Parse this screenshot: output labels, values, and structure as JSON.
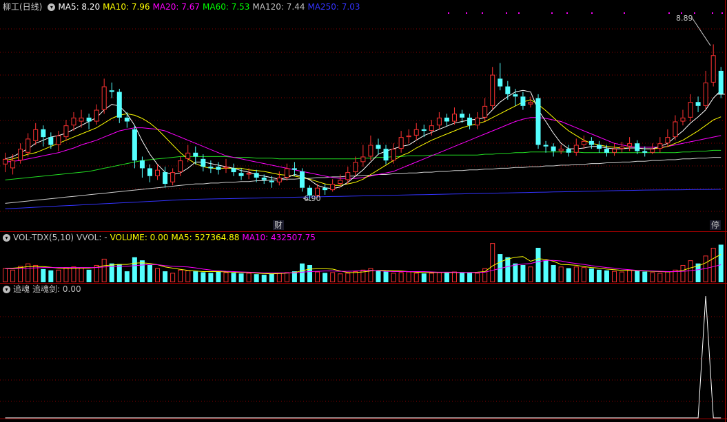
{
  "panel1": {
    "title": "柳工(日线)",
    "indicators": [
      {
        "label": "MA5: 8.20",
        "color": "#ffffff"
      },
      {
        "label": "MA10: 7.96",
        "color": "#ffff00"
      },
      {
        "label": "MA20: 7.67",
        "color": "#ff00ff"
      },
      {
        "label": "MA60: 7.53",
        "color": "#00ff00"
      },
      {
        "label": "MA120: 7.44",
        "color": "#c0c0c0"
      },
      {
        "label": "MA250: 7.03",
        "color": "#3333ff"
      }
    ],
    "high_label": "8.89",
    "low_label": "6.90",
    "marker_cai": "财",
    "marker_ting": "停"
  },
  "panel2": {
    "title": "VOL-TDX(5,10)",
    "indicators": [
      {
        "label": "VVOL: -",
        "color": "#c0c0c0"
      },
      {
        "label": "VOLUME: 0.00",
        "color": "#ffff00"
      },
      {
        "label": "MA5: 527364.88",
        "color": "#ffff00"
      },
      {
        "label": "MA10: 432507.75",
        "color": "#ff00ff"
      }
    ]
  },
  "panel3": {
    "title": "追魂",
    "indicators": [
      {
        "label": "追魂剑: 0.00",
        "color": "#c0c0c0"
      }
    ]
  },
  "colors": {
    "up": "#ff3232",
    "down": "#54ffff",
    "grid": "#8b0000",
    "border": "#b00000"
  },
  "chart_data": {
    "type": "candlestick",
    "title": "柳工(日线)",
    "ylim": [
      6.5,
      9.3
    ],
    "candles": [
      [
        7.35,
        7.42,
        7.5,
        7.25
      ],
      [
        7.3,
        7.4,
        7.48,
        7.22
      ],
      [
        7.4,
        7.55,
        7.62,
        7.36
      ],
      [
        7.5,
        7.68,
        7.75,
        7.45
      ],
      [
        7.65,
        7.8,
        7.88,
        7.6
      ],
      [
        7.8,
        7.7,
        7.85,
        7.58
      ],
      [
        7.7,
        7.6,
        7.76,
        7.55
      ],
      [
        7.6,
        7.72,
        7.78,
        7.52
      ],
      [
        7.7,
        7.85,
        7.92,
        7.65
      ],
      [
        7.85,
        7.95,
        8.02,
        7.78
      ],
      [
        7.9,
        7.95,
        8.05,
        7.82
      ],
      [
        7.95,
        7.9,
        8.0,
        7.8
      ],
      [
        7.9,
        8.05,
        8.12,
        7.86
      ],
      [
        8.05,
        8.35,
        8.45,
        8.0
      ],
      [
        8.3,
        8.28,
        8.4,
        8.2
      ],
      [
        8.28,
        7.95,
        8.32,
        7.88
      ],
      [
        7.95,
        7.9,
        8.02,
        7.82
      ],
      [
        7.8,
        7.4,
        7.85,
        7.3
      ],
      [
        7.4,
        7.3,
        7.45,
        7.18
      ],
      [
        7.3,
        7.2,
        7.35,
        7.12
      ],
      [
        7.2,
        7.28,
        7.35,
        7.15
      ],
      [
        7.25,
        7.1,
        7.32,
        7.05
      ],
      [
        7.12,
        7.25,
        7.3,
        7.08
      ],
      [
        7.25,
        7.4,
        7.45,
        7.2
      ],
      [
        7.42,
        7.5,
        7.6,
        7.38
      ],
      [
        7.5,
        7.45,
        7.58,
        7.35
      ],
      [
        7.42,
        7.32,
        7.48,
        7.26
      ],
      [
        7.32,
        7.3,
        7.4,
        7.24
      ],
      [
        7.32,
        7.28,
        7.38,
        7.22
      ],
      [
        7.3,
        7.32,
        7.42,
        7.24
      ],
      [
        7.3,
        7.25,
        7.36,
        7.2
      ],
      [
        7.24,
        7.2,
        7.3,
        7.15
      ],
      [
        7.22,
        7.24,
        7.3,
        7.16
      ],
      [
        7.24,
        7.18,
        7.28,
        7.12
      ],
      [
        7.18,
        7.15,
        7.22,
        7.1
      ],
      [
        7.14,
        7.12,
        7.2,
        7.05
      ],
      [
        7.12,
        7.18,
        7.26,
        7.08
      ],
      [
        7.18,
        7.3,
        7.36,
        7.14
      ],
      [
        7.3,
        7.28,
        7.38,
        7.2
      ],
      [
        7.26,
        7.05,
        7.3,
        7.0
      ],
      [
        7.05,
        6.95,
        7.08,
        6.9
      ],
      [
        6.95,
        7.05,
        7.1,
        6.92
      ],
      [
        7.05,
        7.02,
        7.1,
        6.96
      ],
      [
        7.02,
        7.1,
        7.16,
        7.0
      ],
      [
        7.1,
        7.15,
        7.22,
        7.06
      ],
      [
        7.15,
        7.25,
        7.32,
        7.1
      ],
      [
        7.25,
        7.38,
        7.45,
        7.2
      ],
      [
        7.38,
        7.45,
        7.6,
        7.32
      ],
      [
        7.45,
        7.6,
        7.72,
        7.4
      ],
      [
        7.6,
        7.55,
        7.68,
        7.48
      ],
      [
        7.55,
        7.4,
        7.6,
        7.35
      ],
      [
        7.4,
        7.55,
        7.62,
        7.36
      ],
      [
        7.55,
        7.7,
        7.78,
        7.5
      ],
      [
        7.7,
        7.72,
        7.8,
        7.62
      ],
      [
        7.72,
        7.8,
        7.88,
        7.66
      ],
      [
        7.8,
        7.78,
        7.86,
        7.7
      ],
      [
        7.78,
        7.85,
        7.92,
        7.72
      ],
      [
        7.85,
        7.95,
        8.02,
        7.8
      ],
      [
        7.95,
        7.9,
        8.0,
        7.84
      ],
      [
        7.9,
        8.0,
        8.08,
        7.86
      ],
      [
        8.0,
        7.95,
        8.05,
        7.88
      ],
      [
        7.95,
        7.85,
        8.0,
        7.8
      ],
      [
        7.85,
        7.95,
        8.02,
        7.8
      ],
      [
        7.95,
        8.1,
        8.2,
        7.9
      ],
      [
        8.1,
        8.5,
        8.6,
        8.05
      ],
      [
        8.45,
        8.35,
        8.65,
        8.3
      ],
      [
        8.35,
        8.25,
        8.42,
        8.18
      ],
      [
        8.25,
        8.22,
        8.32,
        8.1
      ],
      [
        8.22,
        8.1,
        8.28,
        8.05
      ],
      [
        8.12,
        8.15,
        8.22,
        8.08
      ],
      [
        8.2,
        7.6,
        8.25,
        7.55
      ],
      [
        7.6,
        7.58,
        7.65,
        7.5
      ],
      [
        7.58,
        7.52,
        7.62,
        7.45
      ],
      [
        7.52,
        7.55,
        7.6,
        7.48
      ],
      [
        7.55,
        7.5,
        7.6,
        7.45
      ],
      [
        7.5,
        7.6,
        7.68,
        7.46
      ],
      [
        7.6,
        7.65,
        7.72,
        7.55
      ],
      [
        7.65,
        7.6,
        7.7,
        7.55
      ],
      [
        7.6,
        7.55,
        7.65,
        7.5
      ],
      [
        7.55,
        7.5,
        7.6,
        7.45
      ],
      [
        7.5,
        7.55,
        7.62,
        7.46
      ],
      [
        7.55,
        7.58,
        7.64,
        7.5
      ],
      [
        7.58,
        7.62,
        7.7,
        7.52
      ],
      [
        7.62,
        7.52,
        7.66,
        7.48
      ],
      [
        7.52,
        7.5,
        7.58,
        7.45
      ],
      [
        7.5,
        7.55,
        7.62,
        7.48
      ],
      [
        7.55,
        7.62,
        7.7,
        7.5
      ],
      [
        7.62,
        7.7,
        7.8,
        7.58
      ],
      [
        7.7,
        7.9,
        7.98,
        7.66
      ],
      [
        7.9,
        7.95,
        8.05,
        7.85
      ],
      [
        7.95,
        8.15,
        8.25,
        7.9
      ],
      [
        8.15,
        8.1,
        8.22,
        8.02
      ],
      [
        8.1,
        8.4,
        8.55,
        8.05
      ],
      [
        8.4,
        8.75,
        8.89,
        8.35
      ],
      [
        8.55,
        8.25,
        8.6,
        8.2
      ]
    ],
    "ma5": [
      7.42,
      7.45,
      7.5,
      7.55,
      7.62,
      7.66,
      7.7,
      7.72,
      7.75,
      7.8,
      7.85,
      7.9,
      7.95,
      8.05,
      8.12,
      8.1,
      8.0,
      7.85,
      7.65,
      7.48,
      7.35,
      7.25,
      7.22,
      7.24,
      7.3,
      7.38,
      7.38,
      7.36,
      7.34,
      7.32,
      7.3,
      7.27,
      7.25,
      7.22,
      7.2,
      7.18,
      7.16,
      7.18,
      7.22,
      7.2,
      7.15,
      7.08,
      7.05,
      7.04,
      7.06,
      7.12,
      7.2,
      7.28,
      7.38,
      7.48,
      7.52,
      7.55,
      7.58,
      7.6,
      7.66,
      7.72,
      7.76,
      7.8,
      7.84,
      7.88,
      7.9,
      7.92,
      7.93,
      7.95,
      8.05,
      8.15,
      8.22,
      8.28,
      8.3,
      8.28,
      8.05,
      7.9,
      7.75,
      7.62,
      7.55,
      7.55,
      7.56,
      7.58,
      7.58,
      7.56,
      7.55,
      7.55,
      7.56,
      7.56,
      7.55,
      7.55,
      7.58,
      7.62,
      7.7,
      7.78,
      7.88,
      7.96,
      8.05,
      8.2,
      8.3
    ],
    "ma10": [
      7.4,
      7.42,
      7.45,
      7.48,
      7.5,
      7.54,
      7.58,
      7.62,
      7.66,
      7.7,
      7.74,
      7.78,
      7.82,
      7.88,
      7.94,
      7.98,
      8.0,
      7.98,
      7.94,
      7.88,
      7.8,
      7.7,
      7.6,
      7.5,
      7.42,
      7.36,
      7.32,
      7.3,
      7.3,
      7.3,
      7.3,
      7.3,
      7.28,
      7.27,
      7.26,
      7.24,
      7.22,
      7.21,
      7.2,
      7.18,
      7.16,
      7.13,
      7.1,
      7.08,
      7.08,
      7.1,
      7.12,
      7.16,
      7.22,
      7.28,
      7.34,
      7.4,
      7.46,
      7.5,
      7.56,
      7.61,
      7.66,
      7.7,
      7.74,
      7.78,
      7.82,
      7.85,
      7.87,
      7.9,
      7.95,
      8.0,
      8.05,
      8.1,
      8.15,
      8.18,
      8.12,
      8.04,
      7.95,
      7.86,
      7.78,
      7.72,
      7.66,
      7.62,
      7.6,
      7.58,
      7.57,
      7.56,
      7.56,
      7.56,
      7.55,
      7.55,
      7.56,
      7.58,
      7.62,
      7.66,
      7.72,
      7.78,
      7.85,
      7.92,
      7.96
    ],
    "ma20": [
      7.38,
      7.39,
      7.4,
      7.42,
      7.44,
      7.46,
      7.48,
      7.5,
      7.53,
      7.56,
      7.6,
      7.63,
      7.66,
      7.7,
      7.74,
      7.78,
      7.8,
      7.82,
      7.82,
      7.81,
      7.8,
      7.78,
      7.74,
      7.7,
      7.66,
      7.62,
      7.58,
      7.54,
      7.5,
      7.46,
      7.44,
      7.42,
      7.4,
      7.38,
      7.36,
      7.34,
      7.32,
      7.3,
      7.28,
      7.26,
      7.24,
      7.22,
      7.2,
      7.18,
      7.17,
      7.17,
      7.17,
      7.18,
      7.2,
      7.22,
      7.24,
      7.26,
      7.3,
      7.34,
      7.38,
      7.42,
      7.46,
      7.5,
      7.54,
      7.58,
      7.62,
      7.66,
      7.7,
      7.74,
      7.78,
      7.82,
      7.86,
      7.9,
      7.93,
      7.95,
      7.95,
      7.94,
      7.92,
      7.9,
      7.86,
      7.82,
      7.78,
      7.74,
      7.7,
      7.66,
      7.62,
      7.6,
      7.58,
      7.57,
      7.57,
      7.57,
      7.57,
      7.58,
      7.6,
      7.62,
      7.64,
      7.66,
      7.68,
      7.7,
      7.72
    ],
    "ma60": [
      7.15,
      7.16,
      7.17,
      7.18,
      7.19,
      7.2,
      7.21,
      7.22,
      7.23,
      7.24,
      7.25,
      7.26,
      7.28,
      7.3,
      7.32,
      7.34,
      7.36,
      7.38,
      7.4,
      7.41,
      7.42,
      7.43,
      7.44,
      7.45,
      7.45,
      7.45,
      7.45,
      7.45,
      7.45,
      7.45,
      7.44,
      7.44,
      7.44,
      7.43,
      7.43,
      7.43,
      7.42,
      7.42,
      7.42,
      7.42,
      7.42,
      7.42,
      7.42,
      7.42,
      7.42,
      7.42,
      7.42,
      7.43,
      7.43,
      7.44,
      7.44,
      7.45,
      7.45,
      7.46,
      7.46,
      7.46,
      7.47,
      7.47,
      7.47,
      7.47,
      7.47,
      7.47,
      7.47,
      7.48,
      7.48,
      7.49,
      7.49,
      7.5,
      7.5,
      7.51,
      7.51,
      7.51,
      7.51,
      7.51,
      7.51,
      7.51,
      7.5,
      7.5,
      7.5,
      7.5,
      7.5,
      7.5,
      7.5,
      7.5,
      7.5,
      7.5,
      7.5,
      7.5,
      7.5,
      7.51,
      7.51,
      7.52,
      7.52,
      7.53,
      7.53
    ],
    "ma120": [
      6.85,
      6.86,
      6.87,
      6.88,
      6.89,
      6.9,
      6.91,
      6.92,
      6.93,
      6.94,
      6.95,
      6.96,
      6.97,
      6.98,
      6.99,
      7.0,
      7.01,
      7.02,
      7.03,
      7.04,
      7.05,
      7.06,
      7.07,
      7.08,
      7.09,
      7.1,
      7.1,
      7.11,
      7.11,
      7.12,
      7.12,
      7.13,
      7.13,
      7.14,
      7.14,
      7.15,
      7.15,
      7.16,
      7.16,
      7.17,
      7.17,
      7.18,
      7.18,
      7.19,
      7.19,
      7.2,
      7.2,
      7.21,
      7.21,
      7.22,
      7.22,
      7.23,
      7.23,
      7.24,
      7.24,
      7.25,
      7.25,
      7.26,
      7.26,
      7.27,
      7.27,
      7.28,
      7.28,
      7.29,
      7.29,
      7.3,
      7.3,
      7.31,
      7.31,
      7.32,
      7.32,
      7.33,
      7.33,
      7.34,
      7.34,
      7.35,
      7.35,
      7.36,
      7.36,
      7.37,
      7.37,
      7.38,
      7.38,
      7.39,
      7.39,
      7.4,
      7.4,
      7.41,
      7.41,
      7.42,
      7.42,
      7.43,
      7.43,
      7.44,
      7.44
    ],
    "ma250": [
      6.78,
      6.785,
      6.79,
      6.795,
      6.8,
      6.805,
      6.81,
      6.815,
      6.82,
      6.825,
      6.83,
      6.835,
      6.84,
      6.845,
      6.85,
      6.855,
      6.86,
      6.865,
      6.87,
      6.875,
      6.88,
      6.885,
      6.89,
      6.895,
      6.9,
      6.902,
      6.904,
      6.906,
      6.908,
      6.91,
      6.912,
      6.914,
      6.916,
      6.918,
      6.92,
      6.922,
      6.924,
      6.926,
      6.928,
      6.93,
      6.932,
      6.934,
      6.936,
      6.938,
      6.94,
      6.942,
      6.944,
      6.946,
      6.948,
      6.95,
      6.952,
      6.954,
      6.956,
      6.958,
      6.96,
      6.962,
      6.964,
      6.966,
      6.968,
      6.97,
      6.972,
      6.974,
      6.976,
      6.978,
      6.98,
      6.982,
      6.984,
      6.986,
      6.988,
      6.99,
      6.992,
      6.994,
      6.996,
      6.998,
      7.0,
      7.002,
      7.004,
      7.006,
      7.008,
      7.01,
      7.012,
      7.014,
      7.016,
      7.018,
      7.02,
      7.021,
      7.022,
      7.023,
      7.024,
      7.025,
      7.026,
      7.027,
      7.028,
      7.029,
      7.03
    ],
    "volume": [
      45,
      40,
      52,
      60,
      55,
      42,
      38,
      40,
      48,
      50,
      46,
      40,
      55,
      75,
      60,
      58,
      35,
      80,
      70,
      55,
      45,
      35,
      30,
      40,
      38,
      35,
      32,
      30,
      34,
      32,
      30,
      28,
      30,
      26,
      24,
      28,
      30,
      32,
      35,
      60,
      55,
      34,
      30,
      32,
      28,
      30,
      35,
      40,
      45,
      38,
      34,
      30,
      32,
      34,
      30,
      28,
      30,
      32,
      30,
      34,
      32,
      30,
      30,
      45,
      125,
      90,
      80,
      60,
      55,
      50,
      110,
      70,
      55,
      50,
      45,
      50,
      48,
      44,
      40,
      38,
      36,
      34,
      40,
      36,
      34,
      32,
      30,
      35,
      40,
      55,
      70,
      60,
      85,
      110,
      120
    ],
    "vol_ma5": [
      44,
      45,
      47,
      50,
      50,
      50,
      48,
      45,
      44,
      44,
      45,
      45,
      48,
      53,
      55,
      57,
      57,
      61,
      62,
      60,
      56,
      49,
      45,
      41,
      38,
      36,
      34,
      34,
      34,
      33,
      32,
      31,
      31,
      29,
      28,
      27,
      28,
      29,
      31,
      37,
      42,
      43,
      43,
      42,
      36,
      31,
      31,
      33,
      36,
      38,
      38,
      37,
      36,
      34,
      32,
      31,
      31,
      31,
      31,
      31,
      31,
      31,
      32,
      34,
      52,
      65,
      74,
      80,
      82,
      67,
      75,
      73,
      67,
      57,
      56,
      54,
      50,
      47,
      45,
      42,
      40,
      38,
      38,
      37,
      36,
      35,
      34,
      33,
      34,
      38,
      46,
      52,
      62,
      76,
      89
    ],
    "vol_ma10": [
      43,
      43,
      44,
      45,
      46,
      47,
      47,
      47,
      47,
      47,
      47,
      47,
      47,
      49,
      50,
      51,
      51,
      53,
      55,
      57,
      56,
      53,
      51,
      50,
      49,
      46,
      42,
      39,
      37,
      35,
      34,
      33,
      32,
      31,
      30,
      30,
      30,
      30,
      30,
      32,
      34,
      35,
      36,
      36,
      35,
      35,
      36,
      37,
      38,
      37,
      35,
      34,
      34,
      34,
      34,
      34,
      33,
      32,
      32,
      32,
      31,
      31,
      31,
      32,
      38,
      44,
      50,
      55,
      58,
      60,
      66,
      70,
      70,
      68,
      63,
      60,
      57,
      53,
      50,
      47,
      45,
      42,
      40,
      38,
      37,
      36,
      35,
      34,
      34,
      35,
      37,
      40,
      44,
      50,
      56
    ],
    "signal": [
      0,
      0,
      0,
      0,
      0,
      0,
      0,
      0,
      0,
      0,
      0,
      0,
      0,
      0,
      0,
      0,
      0,
      0,
      0,
      0,
      0,
      0,
      0,
      0,
      0,
      0,
      0,
      0,
      0,
      0,
      0,
      0,
      0,
      0,
      0,
      0,
      0,
      0,
      0,
      0,
      0,
      0,
      0,
      0,
      0,
      0,
      0,
      0,
      0,
      0,
      0,
      0,
      0,
      0,
      0,
      0,
      0,
      0,
      0,
      0,
      0,
      0,
      0,
      0,
      0,
      0,
      0,
      0,
      0,
      0,
      0,
      0,
      0,
      0,
      0,
      0,
      0,
      0,
      0,
      0,
      0,
      0,
      0,
      0,
      0,
      0,
      0,
      0,
      0,
      0,
      0,
      0,
      1,
      0,
      0
    ]
  }
}
